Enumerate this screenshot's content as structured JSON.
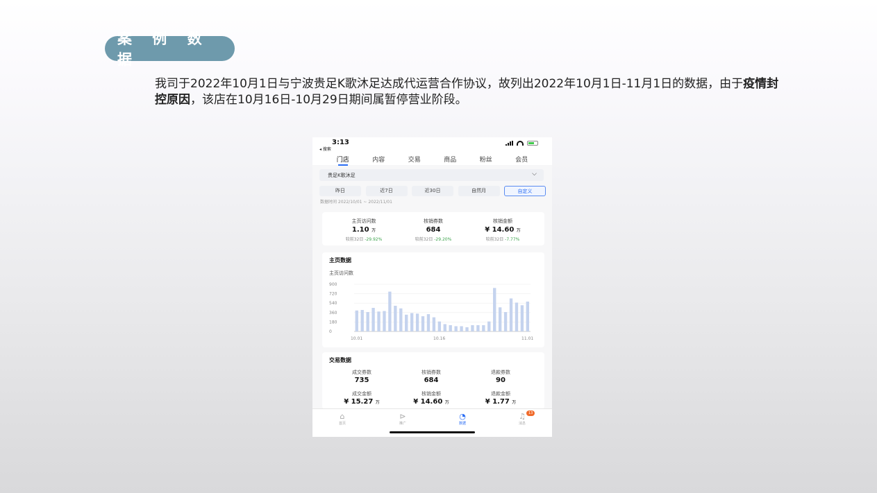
{
  "slide": {
    "badge": "案 例 数 据",
    "intro_part1": "我司于2022年10月1日与宁波贵足K歌沐足达成代运营合作协议，故列出2022年10月1日-11月1日的数据，由于",
    "intro_bold": "疫情封控原因",
    "intro_part2": "，该店在10月16日-10月29日期间属暂停营业阶段。"
  },
  "phone": {
    "time": "3:13",
    "back_label": "◂ 搜索",
    "tabs": [
      "门店",
      "内容",
      "交易",
      "商品",
      "粉丝",
      "会员"
    ],
    "active_tab": 0,
    "store": "贵足K歌沐足",
    "ranges": [
      "昨日",
      "近7日",
      "近30日",
      "自然月",
      "自定义"
    ],
    "selected_range": 4,
    "period": "数据时间   2022/10/01 ~ 2022/11/01",
    "kpis": [
      {
        "label": "主页访问数",
        "value": "1.10",
        "unit": "万",
        "compare": "较前32日",
        "change": "-29.92%"
      },
      {
        "label": "核销券数",
        "value": "684",
        "unit": "",
        "compare": "较前32日",
        "change": "-29.20%"
      },
      {
        "label": "核销金额",
        "value": "¥ 14.60",
        "unit": "万",
        "compare": "较前32日",
        "change": "-7.77%"
      }
    ],
    "homepage_title": "主页数据",
    "homepage_sub": "主页访问数",
    "trade_title": "交易数据",
    "trade": [
      {
        "label": "成交券数",
        "value": "735",
        "unit": ""
      },
      {
        "label": "核销券数",
        "value": "684",
        "unit": ""
      },
      {
        "label": "退款券数",
        "value": "90",
        "unit": ""
      },
      {
        "label": "成交金额",
        "value": "¥ 15.27",
        "unit": "万"
      },
      {
        "label": "核销金额",
        "value": "¥ 14.60",
        "unit": "万"
      },
      {
        "label": "退款金额",
        "value": "¥ 1.77",
        "unit": "万"
      }
    ],
    "nav": [
      {
        "label": "首页",
        "icon": "home-icon"
      },
      {
        "label": "推广",
        "icon": "megaphone-icon"
      },
      {
        "label": "数据",
        "icon": "pie-chart-icon"
      },
      {
        "label": "消息",
        "icon": "bell-icon"
      }
    ],
    "active_nav": 2,
    "nav_badge": "13"
  },
  "chart_data": {
    "type": "bar",
    "title": "主页访问数",
    "yticks": [
      0,
      180,
      360,
      540,
      720,
      900
    ],
    "ylim": [
      0,
      900
    ],
    "xticks": [
      "10.01",
      "10.16",
      "11.01"
    ],
    "bar_color": "#c5d3ee",
    "grid": true,
    "values": [
      400,
      410,
      370,
      450,
      380,
      390,
      760,
      490,
      440,
      320,
      350,
      340,
      290,
      330,
      270,
      190,
      140,
      120,
      100,
      100,
      80,
      120,
      120,
      120,
      190,
      830,
      460,
      370,
      630,
      550,
      500,
      570
    ]
  }
}
